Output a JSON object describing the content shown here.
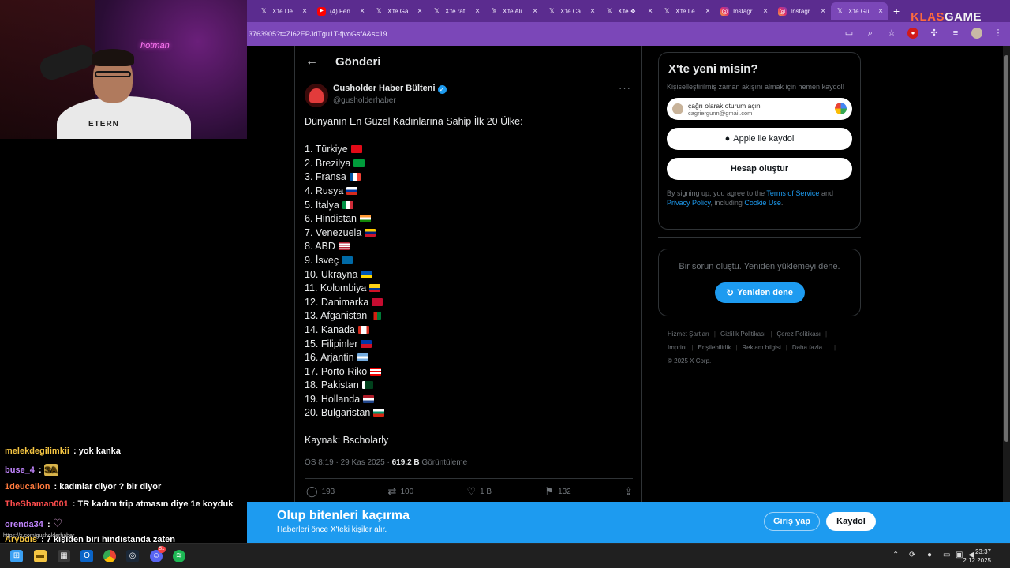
{
  "browser": {
    "tabs": [
      {
        "icon": "x-icon",
        "title": "X'te De",
        "active": false
      },
      {
        "icon": "youtube-icon",
        "title": "(4) Fen",
        "active": false
      },
      {
        "icon": "x-icon",
        "title": "X'te Ga",
        "active": false
      },
      {
        "icon": "x-icon",
        "title": "X'te raf",
        "active": false
      },
      {
        "icon": "x-icon",
        "title": "X'te Ali",
        "active": false
      },
      {
        "icon": "x-icon",
        "title": "X'te Ca",
        "active": false
      },
      {
        "icon": "x-icon",
        "title": "X'te ❖",
        "active": false
      },
      {
        "icon": "x-icon",
        "title": "X'te Le",
        "active": false
      },
      {
        "icon": "instagram-icon",
        "title": "Instagr",
        "active": false
      },
      {
        "icon": "instagram-icon",
        "title": "Instagr",
        "active": false
      },
      {
        "icon": "x-icon",
        "title": "X'te Gu",
        "active": true
      }
    ],
    "url": "3763905?t=ZI62EPJdTgu1T-fjvoGsfA&s=19",
    "brand_left": "KLAS",
    "brand_right": "GAME"
  },
  "stream": {
    "webcam_text": "ETERN",
    "neon_text": "hotman",
    "chat": [
      {
        "user": "melekdegilimkii",
        "user_color": "#f5c542",
        "text": "yok kanka",
        "emote": ""
      },
      {
        "user": "buse_4",
        "user_color": "#c084fc",
        "text": "",
        "emote": "SA"
      },
      {
        "user": "1deucalion",
        "user_color": "#ff7a3d",
        "text": "kadınlar diyor ? bir diyor",
        "emote": ""
      },
      {
        "user": "TheShaman001",
        "user_color": "#ff4d4d",
        "text": "TR kadını trip atmasın diye 1e koyduk",
        "emote": ""
      },
      {
        "user": "orenda34",
        "user_color": "#c084fc",
        "text": "",
        "emote": "♡"
      },
      {
        "user": "Arybdis",
        "user_color": "#f5c542",
        "text": "7 kişiden biri hindistanda zaten",
        "emote": ""
      }
    ],
    "tiny_url": "https://x.com/gusholderhaber"
  },
  "post": {
    "header_title": "Gönderi",
    "author_name": "Gusholder Haber Bülteni",
    "author_handle": "@gusholderhaber",
    "intro": "Dünyanın En Güzel Kadınlarına Sahip İlk 20 Ülke:",
    "items": [
      {
        "label": "1. Türkiye",
        "flag": "tr"
      },
      {
        "label": "2. Brezilya",
        "flag": "br"
      },
      {
        "label": "3. Fransa",
        "flag": "fr"
      },
      {
        "label": "4. Rusya",
        "flag": "ru"
      },
      {
        "label": "5. İtalya",
        "flag": "it"
      },
      {
        "label": "6. Hindistan",
        "flag": "in"
      },
      {
        "label": "7. Venezuela",
        "flag": "ve"
      },
      {
        "label": "8. ABD",
        "flag": "us"
      },
      {
        "label": "9. İsveç",
        "flag": "se"
      },
      {
        "label": "10. Ukrayna",
        "flag": "ua"
      },
      {
        "label": "11. Kolombiya",
        "flag": "co"
      },
      {
        "label": "12. Danimarka",
        "flag": "dk"
      },
      {
        "label": "13. Afganistan",
        "flag": "af"
      },
      {
        "label": "14. Kanada",
        "flag": "ca"
      },
      {
        "label": "15. Filipinler",
        "flag": "ph"
      },
      {
        "label": "16. Arjantin",
        "flag": "ar"
      },
      {
        "label": "17. Porto Riko",
        "flag": "pr"
      },
      {
        "label": "18. Pakistan",
        "flag": "pk"
      },
      {
        "label": "19. Hollanda",
        "flag": "nl"
      },
      {
        "label": "20. Bulgaristan",
        "flag": "bg"
      }
    ],
    "source": "Kaynak: Bscholarly",
    "timestamp": "ÖS 8:19 · 29 Kas 2025 · ",
    "views": "619,2 B",
    "views_label": " Görüntüleme",
    "replies": "193",
    "reposts": "100",
    "likes": "1 B",
    "bookmarks": "132"
  },
  "sidebar": {
    "signup_title": "X'te yeni misin?",
    "signup_sub": "Kişiselleştirilmiş zaman akışını almak için hemen kaydol!",
    "google_line1": "çağrı olarak oturum açın",
    "google_line2": "cagriergunn@gmail.com",
    "apple_label": "Apple ile kaydol",
    "create_label": "Hesap oluştur",
    "terms_pre": "By signing up, you agree to the ",
    "terms_link": "Terms of Service",
    "terms_mid": " and ",
    "privacy_link": "Privacy Policy",
    "terms_mid2": ", including ",
    "cookie_link": "Cookie Use",
    "terms_end": ".",
    "error_text": "Bir sorun oluştu. Yeniden yüklemeyi dene.",
    "retry_label": "Yeniden dene",
    "footer_row1": [
      "Hizmet Şartları",
      "Gizlilik Politikası",
      "Çerez Politikası"
    ],
    "footer_row2": [
      "Imprint",
      "Erişilebilirlik",
      "Reklam bilgisi",
      "Daha fazla ..."
    ],
    "copyright": "© 2025 X Corp."
  },
  "banner": {
    "title": "Olup bitenleri kaçırma",
    "subtitle": "Haberleri önce X'teki kişiler alır.",
    "login_label": "Giriş yap",
    "register_label": "Kaydol"
  },
  "taskbar": {
    "time": "23:37",
    "date": "2.12.2025",
    "discord_badge": "51"
  }
}
